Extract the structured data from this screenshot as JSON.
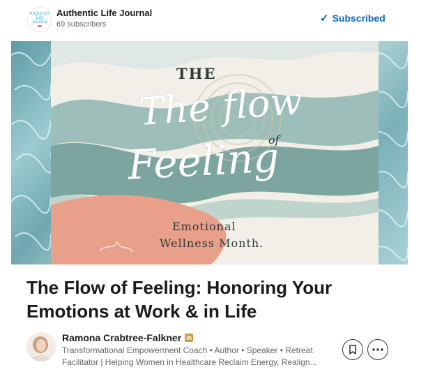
{
  "publication": {
    "logo_lines": [
      "Authentic",
      "Life",
      "Journal"
    ],
    "name": "Authentic Life Journal",
    "subscribers": "69 subscribers",
    "subscribe_state": "Subscribed"
  },
  "cover": {
    "the": "THE",
    "script_line1": "The flow",
    "of": "of",
    "script_line2": "Feeling",
    "subtitle_line1": "Emotional",
    "subtitle_line2": "Wellness Month."
  },
  "article": {
    "title": "The Flow of Feeling: Honoring Your Emotions at Work & in Life"
  },
  "author": {
    "name": "Ramona Crabtree-Falkner",
    "badge": "in",
    "headline_line1": "Transformational Empowerment Coach • Author • Speaker • Retreat",
    "headline_line2": "Facilitator | Helping Women in Healthcare Reclaim Energy, Realign..."
  },
  "icons": {
    "subscribed": "check-icon",
    "save": "bookmark-icon",
    "more": "more-horizontal-icon"
  },
  "colors": {
    "accent": "#0a66c2",
    "cover_peach": "#e9a08a",
    "cover_teal": "#6f9c98",
    "badge_gold": "#c99b3b"
  }
}
